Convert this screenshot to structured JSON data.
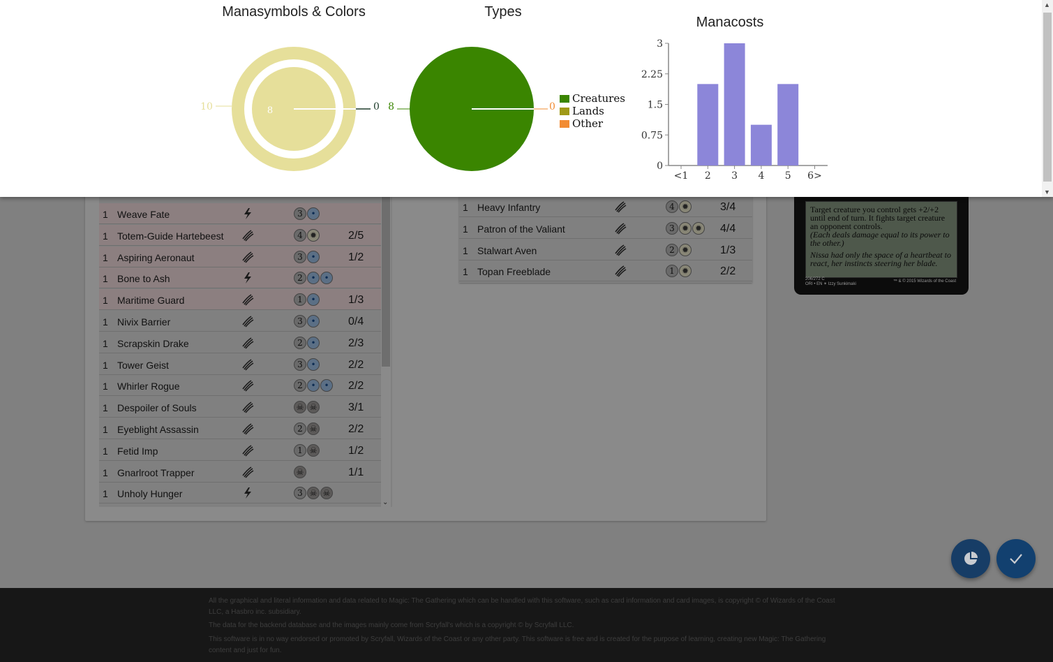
{
  "stats": {
    "mana_title": "Manasymbols & Colors",
    "types_title": "Types",
    "costs_title": "Manacosts"
  },
  "chart_data": [
    {
      "type": "pie",
      "title": "Manasymbols & Colors",
      "rings": [
        {
          "name": "outer",
          "values": [
            {
              "value": 10,
              "color": "#e6df9a"
            },
            {
              "value": 0,
              "color": "#1e3d2b"
            }
          ]
        },
        {
          "name": "inner",
          "values": [
            {
              "value": 8,
              "color": "#e6df9a"
            }
          ]
        }
      ],
      "labels": [
        "10",
        "0",
        "8"
      ]
    },
    {
      "type": "pie",
      "title": "Types",
      "categories": [
        "Creatures",
        "Lands",
        "Other"
      ],
      "values": [
        8,
        0,
        0
      ],
      "colors": [
        "#3a8500",
        "#a09a17",
        "#f28c33"
      ],
      "labels": [
        "8",
        "0"
      ],
      "legend": "right"
    },
    {
      "type": "bar",
      "title": "Manacosts",
      "categories": [
        "<1",
        "2",
        "3",
        "4",
        "5",
        "6>"
      ],
      "values": [
        0,
        2,
        3,
        1,
        2,
        0
      ],
      "ylim": [
        0,
        3
      ],
      "yticks": [
        "0",
        "0.75",
        "1.5",
        "2.25",
        "3"
      ],
      "color": "#8c86d9"
    }
  ],
  "left_list": [
    {
      "qty": "1",
      "name": "Weave Fate",
      "type": "instant",
      "cost": [
        {
          "s": "3",
          "c": ""
        },
        {
          "s": "•",
          "c": "blue"
        }
      ],
      "pt": "",
      "pink": true
    },
    {
      "qty": "1",
      "name": "Totem-Guide Hartebeest",
      "type": "creature",
      "cost": [
        {
          "s": "4",
          "c": ""
        },
        {
          "s": "✹",
          "c": "white"
        }
      ],
      "pt": "2/5",
      "pink": true
    },
    {
      "qty": "1",
      "name": "Aspiring Aeronaut",
      "type": "creature",
      "cost": [
        {
          "s": "3",
          "c": ""
        },
        {
          "s": "•",
          "c": "blue"
        }
      ],
      "pt": "1/2",
      "pink": true
    },
    {
      "qty": "1",
      "name": "Bone to Ash",
      "type": "instant",
      "cost": [
        {
          "s": "2",
          "c": ""
        },
        {
          "s": "•",
          "c": "blue"
        },
        {
          "s": "•",
          "c": "blue"
        }
      ],
      "pt": "",
      "pink": true
    },
    {
      "qty": "1",
      "name": "Maritime Guard",
      "type": "creature",
      "cost": [
        {
          "s": "1",
          "c": ""
        },
        {
          "s": "•",
          "c": "blue"
        }
      ],
      "pt": "1/3",
      "pink": true
    },
    {
      "qty": "1",
      "name": "Nivix Barrier",
      "type": "creature",
      "cost": [
        {
          "s": "3",
          "c": ""
        },
        {
          "s": "•",
          "c": "blue"
        }
      ],
      "pt": "0/4",
      "pink": false
    },
    {
      "qty": "1",
      "name": "Scrapskin Drake",
      "type": "creature",
      "cost": [
        {
          "s": "2",
          "c": ""
        },
        {
          "s": "•",
          "c": "blue"
        }
      ],
      "pt": "2/3",
      "pink": false
    },
    {
      "qty": "1",
      "name": "Tower Geist",
      "type": "creature",
      "cost": [
        {
          "s": "3",
          "c": ""
        },
        {
          "s": "•",
          "c": "blue"
        }
      ],
      "pt": "2/2",
      "pink": false
    },
    {
      "qty": "1",
      "name": "Whirler Rogue",
      "type": "creature",
      "cost": [
        {
          "s": "2",
          "c": ""
        },
        {
          "s": "•",
          "c": "blue"
        },
        {
          "s": "•",
          "c": "blue"
        }
      ],
      "pt": "2/2",
      "pink": false
    },
    {
      "qty": "1",
      "name": "Despoiler of Souls",
      "type": "creature",
      "cost": [
        {
          "s": "☠",
          "c": "black"
        },
        {
          "s": "☠",
          "c": "black"
        }
      ],
      "pt": "3/1",
      "pink": false
    },
    {
      "qty": "1",
      "name": "Eyeblight Assassin",
      "type": "creature",
      "cost": [
        {
          "s": "2",
          "c": ""
        },
        {
          "s": "☠",
          "c": "black"
        }
      ],
      "pt": "2/2",
      "pink": false
    },
    {
      "qty": "1",
      "name": "Fetid Imp",
      "type": "creature",
      "cost": [
        {
          "s": "1",
          "c": ""
        },
        {
          "s": "☠",
          "c": "black"
        }
      ],
      "pt": "1/2",
      "pink": false
    },
    {
      "qty": "1",
      "name": "Gnarlroot Trapper",
      "type": "creature",
      "cost": [
        {
          "s": "☠",
          "c": "black"
        }
      ],
      "pt": "1/1",
      "pink": false
    },
    {
      "qty": "1",
      "name": "Unholy Hunger",
      "type": "instant",
      "cost": [
        {
          "s": "3",
          "c": ""
        },
        {
          "s": "☠",
          "c": "black"
        },
        {
          "s": "☠",
          "c": "black"
        }
      ],
      "pt": "",
      "pink": false
    }
  ],
  "right_list": [
    {
      "qty": "1",
      "name": "Heavy Infantry",
      "type": "creature",
      "cost": [
        {
          "s": "4",
          "c": ""
        },
        {
          "s": "✹",
          "c": "white"
        }
      ],
      "pt": "3/4",
      "pink": false
    },
    {
      "qty": "1",
      "name": "Patron of the Valiant",
      "type": "creature",
      "cost": [
        {
          "s": "3",
          "c": ""
        },
        {
          "s": "✹",
          "c": "white"
        },
        {
          "s": "✹",
          "c": "white"
        }
      ],
      "pt": "4/4",
      "pink": false
    },
    {
      "qty": "1",
      "name": "Stalwart Aven",
      "type": "creature",
      "cost": [
        {
          "s": "2",
          "c": ""
        },
        {
          "s": "✹",
          "c": "white"
        }
      ],
      "pt": "1/3",
      "pink": false
    },
    {
      "qty": "1",
      "name": "Topan Freeblade",
      "type": "creature",
      "cost": [
        {
          "s": "1",
          "c": ""
        },
        {
          "s": "✹",
          "c": "white"
        }
      ],
      "pt": "2/2",
      "pink": false
    }
  ],
  "card": {
    "rules": "Target creature you control gets +2/+2 until end of turn. It fights target creature an opponent controls.",
    "reminder": "(Each deals damage equal to its power to the other.)",
    "flavor": "Nissa had only the space of a heartbeat to react, her instincts steering her blade.",
    "collector": "206/272 C",
    "set_line": "ORI • EN ✴ Izzy Sunkimaki",
    "copyright": "™ & © 2015 Wizards of the Coast"
  },
  "footer": {
    "line1": "All the graphical and literal information and data related to Magic: The Gathering which can be handled with this software, such as card information and card images, is copyright © of Wizards of the Coast LLC, a Hasbro inc. subsidiary.",
    "line2": "The data for the backend database and the images mainly come from Scryfall's which is a copyright © by Scryfall LLC.",
    "line3": "This software is in no way endorsed or promoted by Scryfall, Wizards of the Coast or any other party. This software is free and is created for the purpose of learning, creating new Magic: The Gathering content and just for fun."
  },
  "icons": {
    "stats_button": "pie-chart-icon",
    "confirm_button": "check-icon"
  }
}
